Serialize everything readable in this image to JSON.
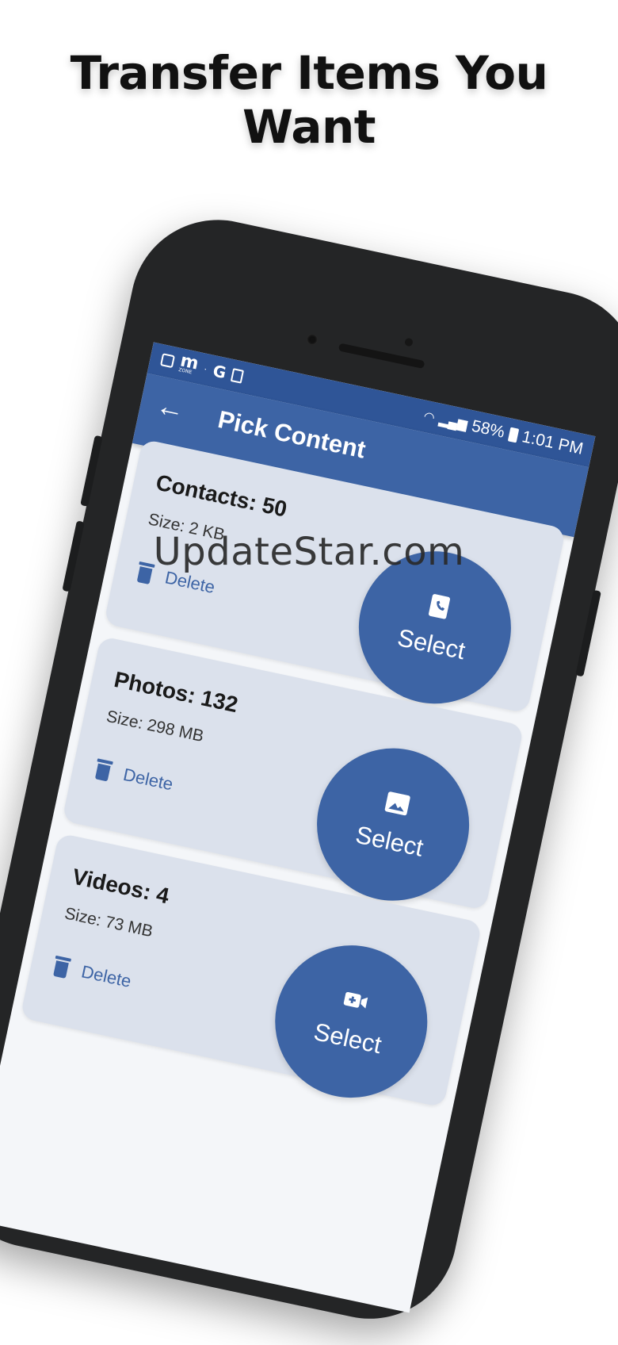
{
  "headline": {
    "line1": "Transfer Items You",
    "line2": "Want"
  },
  "status_bar": {
    "notif_m": "m",
    "notif_zone": "ZONE",
    "notif_dot": "·",
    "notif_g": "G",
    "battery_percent": "58%",
    "time": "1:01 PM"
  },
  "app_bar": {
    "back_icon": "arrow-left-icon",
    "title": "Pick Content"
  },
  "items": [
    {
      "title": "Contacts: 50",
      "size": "Size: 2 KB",
      "delete_label": "Delete",
      "select_label": "Select",
      "icon": "contact-book-icon"
    },
    {
      "title": "Photos: 132",
      "size": "Size: 298 MB",
      "delete_label": "Delete",
      "select_label": "Select",
      "icon": "image-icon"
    },
    {
      "title": "Videos: 4",
      "size": "Size: 73 MB",
      "delete_label": "Delete",
      "select_label": "Select",
      "icon": "video-camera-icon"
    }
  ],
  "watermark": "UpdateStar.com",
  "colors": {
    "primary": "#3d64a5",
    "status_bar": "#2f5597",
    "card": "#dbe1ec",
    "phone_body": "#242526"
  }
}
